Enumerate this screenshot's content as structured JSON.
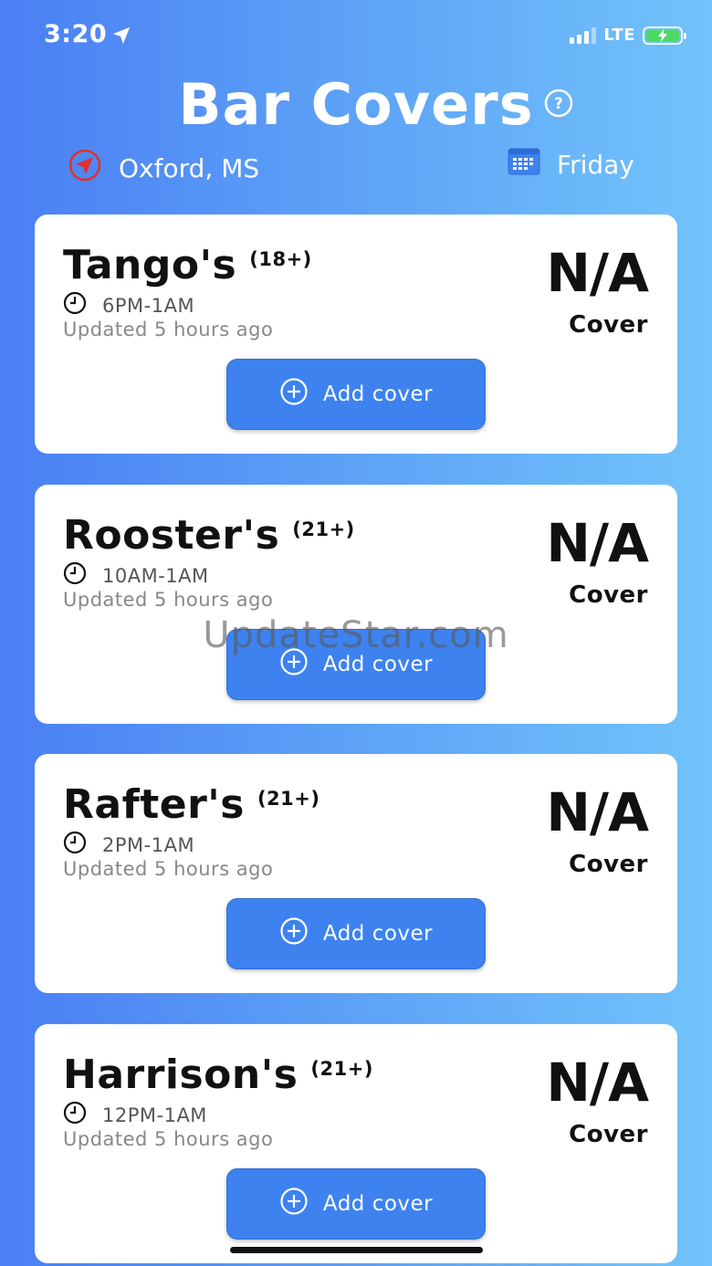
{
  "status_bar": {
    "time": "3:20",
    "network": "LTE"
  },
  "header": {
    "title": "Bar Covers"
  },
  "filters": {
    "location": "Oxford, MS",
    "day": "Friday"
  },
  "bars": [
    {
      "name": "Tango's",
      "age": "(18+)",
      "hours": "6PM-1AM",
      "updated": "Updated 5 hours ago",
      "cover": "N/A",
      "cover_label": "Cover",
      "button_label": "Add cover"
    },
    {
      "name": "Rooster's",
      "age": "(21+)",
      "hours": "10AM-1AM",
      "updated": "Updated 5 hours ago",
      "cover": "N/A",
      "cover_label": "Cover",
      "button_label": "Add cover"
    },
    {
      "name": "Rafter's",
      "age": "(21+)",
      "hours": "2PM-1AM",
      "updated": "Updated 5 hours ago",
      "cover": "N/A",
      "cover_label": "Cover",
      "button_label": "Add cover"
    },
    {
      "name": "Harrison's",
      "age": "(21+)",
      "hours": "12PM-1AM",
      "updated": "Updated 5 hours ago",
      "cover": "N/A",
      "cover_label": "Cover",
      "button_label": "Add cover"
    }
  ],
  "watermark": "UpdateStar.com",
  "colors": {
    "accent": "#3d82ef",
    "location_pin": "#e0302a",
    "battery": "#4cd964"
  },
  "icons": [
    "location-arrow-icon",
    "signal-icon",
    "battery-icon",
    "help-icon",
    "location-pin-icon",
    "calendar-icon",
    "clock-icon",
    "plus-circle-icon"
  ]
}
